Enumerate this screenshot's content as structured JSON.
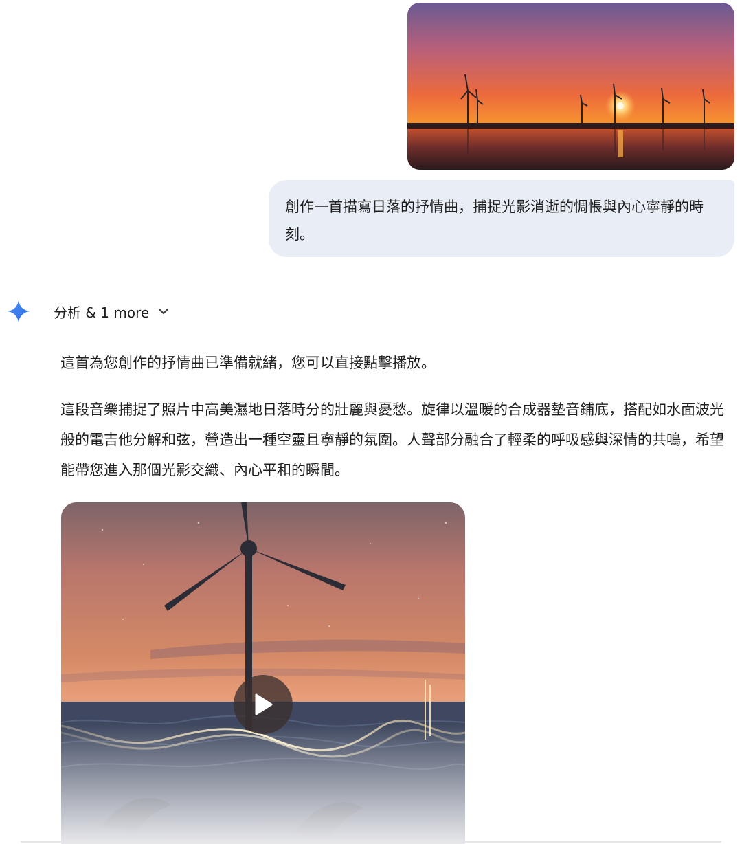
{
  "user_message": {
    "text": "創作一首描寫日落的抒情曲，捕捉光影消逝的惆悵與內心寧靜的時刻。"
  },
  "model_response": {
    "thoughts_label": "分析 & 1 more",
    "paragraphs": [
      "這首為您創作的抒情曲已準備就緒，您可以直接點擊播放。",
      "這段音樂捕捉了照片中高美濕地日落時分的壯麗與憂愁。旋律以溫暖的合成器墊音鋪底，搭配如水面波光般的電吉他分解和弦，營造出一種空靈且寧靜的氛圍。人聲部分融合了輕柔的呼吸感與深情的共鳴，希望能帶您進入那個光影交織、內心平和的瞬間。"
    ]
  },
  "icons": {
    "assistant": "gemini-sparkle-icon",
    "expand": "chevron-down-icon",
    "play": "play-icon"
  },
  "colors": {
    "user_bubble": "#e9eef6",
    "sparkle_blue": "#4285f4",
    "text": "#1f1f1f"
  }
}
